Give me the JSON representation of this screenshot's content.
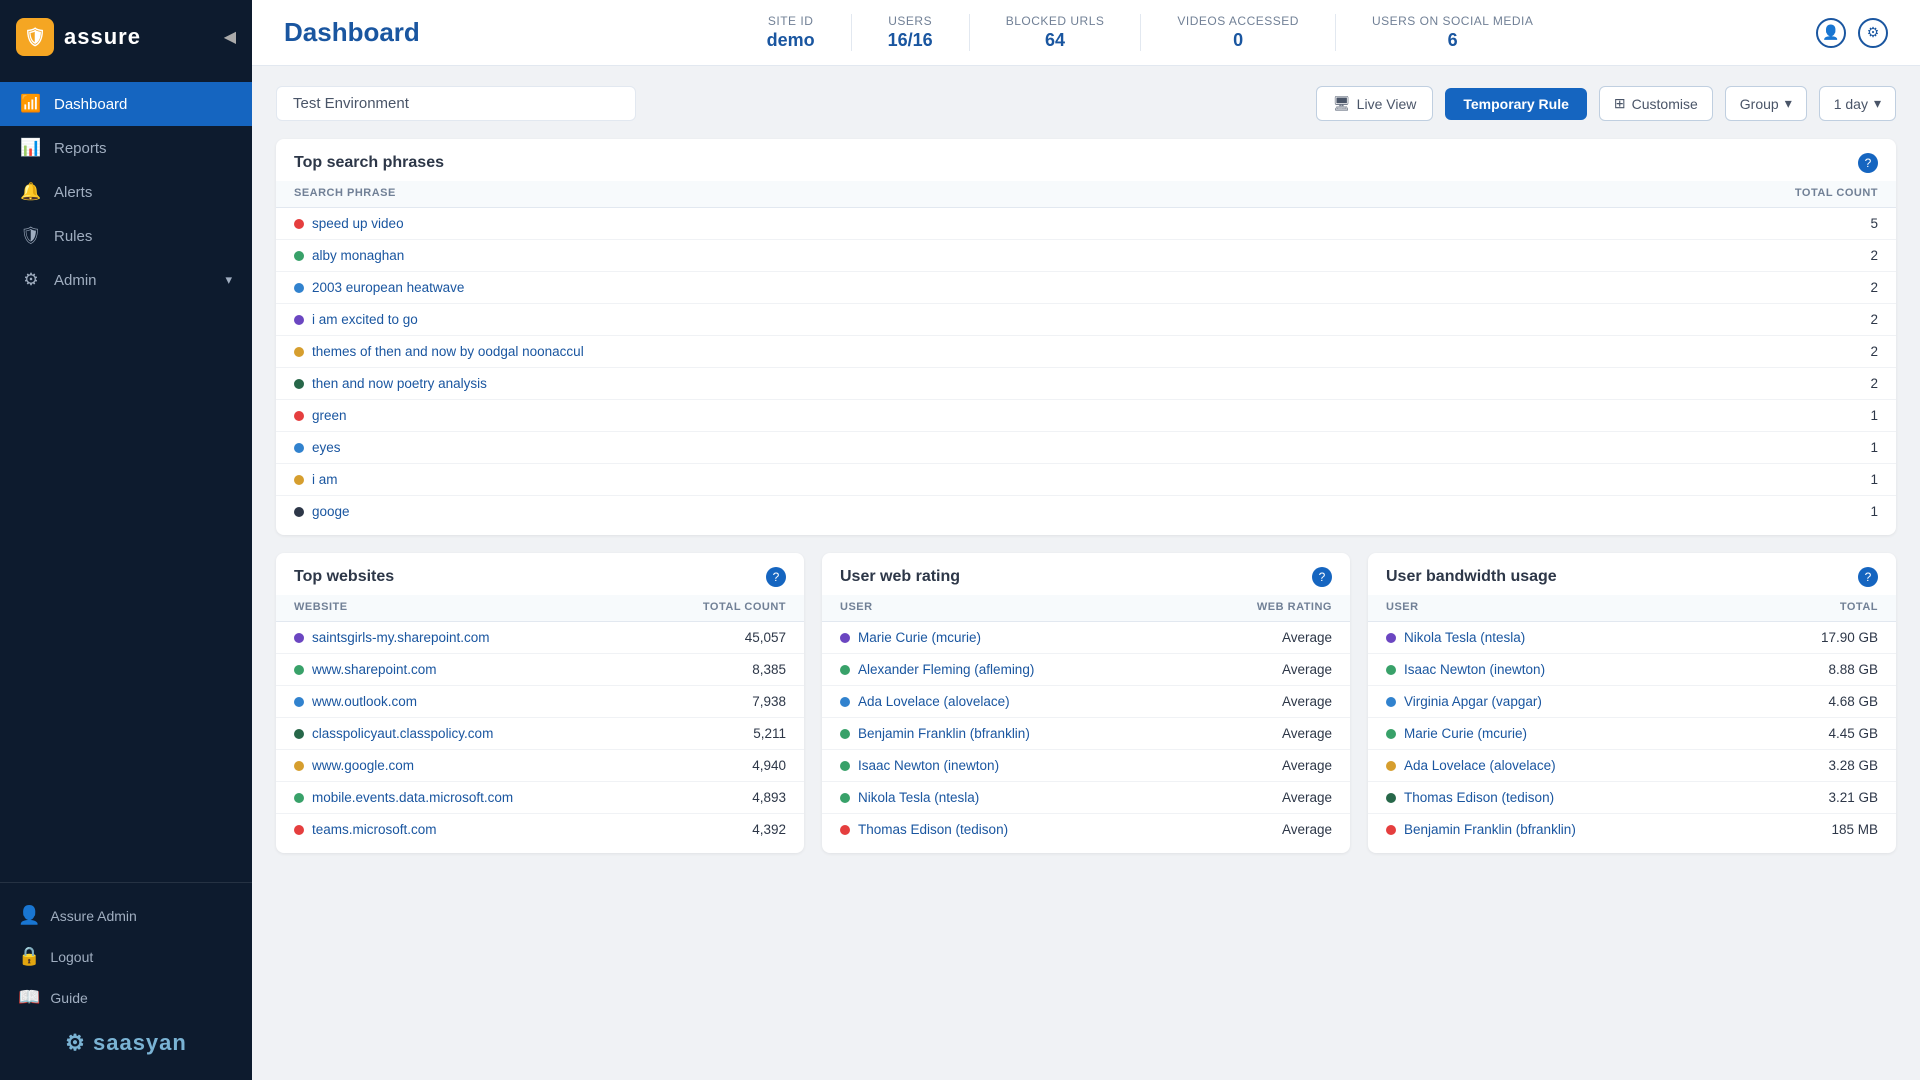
{
  "sidebar": {
    "logo_text": "assure",
    "collapse_icon": "◀",
    "nav_items": [
      {
        "id": "dashboard",
        "label": "Dashboard",
        "icon": "📶",
        "active": true
      },
      {
        "id": "reports",
        "label": "Reports",
        "icon": "📊",
        "active": false
      },
      {
        "id": "alerts",
        "label": "Alerts",
        "icon": "🔔",
        "active": false
      },
      {
        "id": "rules",
        "label": "Rules",
        "icon": "🛡",
        "active": false
      },
      {
        "id": "admin",
        "label": "Admin",
        "icon": "⚙",
        "active": false,
        "has_chevron": true
      }
    ],
    "user_items": [
      {
        "id": "user",
        "label": "Assure Admin",
        "icon": "👤"
      },
      {
        "id": "logout",
        "label": "Logout",
        "icon": "🔒"
      },
      {
        "id": "guide",
        "label": "Guide",
        "icon": "📖"
      }
    ],
    "brand": "saasyan"
  },
  "header": {
    "title": "Dashboard",
    "stats": [
      {
        "label": "Site ID",
        "value": "demo"
      },
      {
        "label": "Users",
        "value": "16/16"
      },
      {
        "label": "Blocked URLs",
        "value": "64"
      },
      {
        "label": "Videos Accessed",
        "value": "0"
      },
      {
        "label": "Users on Social Media",
        "value": "6"
      }
    ]
  },
  "toolbar": {
    "environment": "Test Environment",
    "live_view_label": "Live View",
    "temp_rule_label": "Temporary Rule",
    "customise_label": "Customise",
    "group_label": "Group",
    "day_label": "1 day"
  },
  "top_search_phrases": {
    "title": "Top search phrases",
    "columns": [
      "Search Phrase",
      "Total Count"
    ],
    "rows": [
      {
        "phrase": "speed up video",
        "count": "5",
        "color": "#e53e3e"
      },
      {
        "phrase": "alby monaghan",
        "count": "2",
        "color": "#38a169"
      },
      {
        "phrase": "2003 european heatwave",
        "count": "2",
        "color": "#3182ce"
      },
      {
        "phrase": "i am excited to go",
        "count": "2",
        "color": "#6b46c1"
      },
      {
        "phrase": "themes of then and now by oodgal noonaccul",
        "count": "2",
        "color": "#d69e2e"
      },
      {
        "phrase": "then and now poetry analysis",
        "count": "2",
        "color": "#276749"
      },
      {
        "phrase": "green",
        "count": "1",
        "color": "#e53e3e"
      },
      {
        "phrase": "eyes",
        "count": "1",
        "color": "#3182ce"
      },
      {
        "phrase": "i am",
        "count": "1",
        "color": "#d69e2e"
      },
      {
        "phrase": "googe",
        "count": "1",
        "color": "#2d3748"
      }
    ]
  },
  "top_websites": {
    "title": "Top websites",
    "columns": [
      "Website",
      "Total Count"
    ],
    "rows": [
      {
        "website": "saintsgirls-my.sharepoint.com",
        "count": "45,057",
        "color": "#6b46c1"
      },
      {
        "website": "www.sharepoint.com",
        "count": "8,385",
        "color": "#38a169"
      },
      {
        "website": "www.outlook.com",
        "count": "7,938",
        "color": "#3182ce"
      },
      {
        "website": "classpolicyaut.classpolicy.com",
        "count": "5,211",
        "color": "#276749"
      },
      {
        "website": "www.google.com",
        "count": "4,940",
        "color": "#d69e2e"
      },
      {
        "website": "mobile.events.data.microsoft.com",
        "count": "4,893",
        "color": "#38a169"
      },
      {
        "website": "teams.microsoft.com",
        "count": "4,392",
        "color": "#e53e3e"
      }
    ]
  },
  "user_web_rating": {
    "title": "User web rating",
    "columns": [
      "User",
      "Web Rating"
    ],
    "rows": [
      {
        "user": "Marie Curie (mcurie)",
        "rating": "Average",
        "color": "#6b46c1"
      },
      {
        "user": "Alexander Fleming (afleming)",
        "rating": "Average",
        "color": "#38a169"
      },
      {
        "user": "Ada Lovelace (alovelace)",
        "rating": "Average",
        "color": "#3182ce"
      },
      {
        "user": "Benjamin Franklin (bfranklin)",
        "rating": "Average",
        "color": "#38a169"
      },
      {
        "user": "Isaac Newton (inewton)",
        "rating": "Average",
        "color": "#38a169"
      },
      {
        "user": "Nikola Tesla (ntesla)",
        "rating": "Average",
        "color": "#38a169"
      },
      {
        "user": "Thomas Edison (tedison)",
        "rating": "Average",
        "color": "#e53e3e"
      }
    ]
  },
  "user_bandwidth": {
    "title": "User bandwidth usage",
    "columns": [
      "User",
      "Total"
    ],
    "rows": [
      {
        "user": "Nikola Tesla (ntesla)",
        "total": "17.90 GB",
        "color": "#6b46c1"
      },
      {
        "user": "Isaac Newton (inewton)",
        "total": "8.88 GB",
        "color": "#38a169"
      },
      {
        "user": "Virginia Apgar (vapgar)",
        "total": "4.68 GB",
        "color": "#3182ce"
      },
      {
        "user": "Marie Curie (mcurie)",
        "total": "4.45 GB",
        "color": "#38a169"
      },
      {
        "user": "Ada Lovelace (alovelace)",
        "total": "3.28 GB",
        "color": "#d69e2e"
      },
      {
        "user": "Thomas Edison (tedison)",
        "total": "3.21 GB",
        "color": "#276749"
      },
      {
        "user": "Benjamin Franklin (bfranklin)",
        "total": "185 MB",
        "color": "#e53e3e"
      }
    ]
  }
}
